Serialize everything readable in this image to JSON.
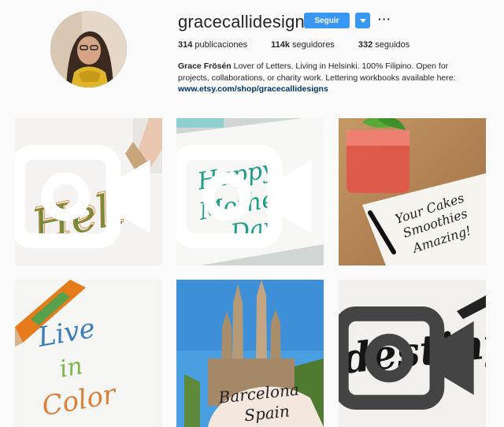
{
  "profile": {
    "username": "gracecallidesigns",
    "follow_label": "Seguir",
    "dropdown_icon": "caret-down-icon",
    "more_label": "···",
    "stats": {
      "posts_count": "314",
      "posts_label": " publicaciones",
      "followers_count": "114k",
      "followers_label": " seguidores",
      "following_count": "332",
      "following_label": " seguidos"
    },
    "bio": {
      "name": "Grace Frösén",
      "text": " Lover of Letters. Living in Helsinki. 100% Filipino. Open for projects, collaborations, or charity work. Lettering workbooks available here:",
      "link": "www.etsy.com/shop/gracecallidesigns"
    }
  },
  "colors": {
    "accent": "#3897f0",
    "link": "#003569",
    "background": "#fafafa"
  },
  "posts": [
    {
      "lettering": "Hello",
      "video": true,
      "icon": "video-camera-icon"
    },
    {
      "lettering": "Happy Mother's Day",
      "video": true,
      "icon": "video-camera-icon"
    },
    {
      "lettering": "Your Cakes and Smoothies are Amazing!",
      "video": false
    },
    {
      "lettering": "Live in Color",
      "video": false
    },
    {
      "lettering": "Barcelona Spain",
      "video": false
    },
    {
      "lettering": "destiny",
      "video": true,
      "icon": "video-camera-icon"
    }
  ]
}
